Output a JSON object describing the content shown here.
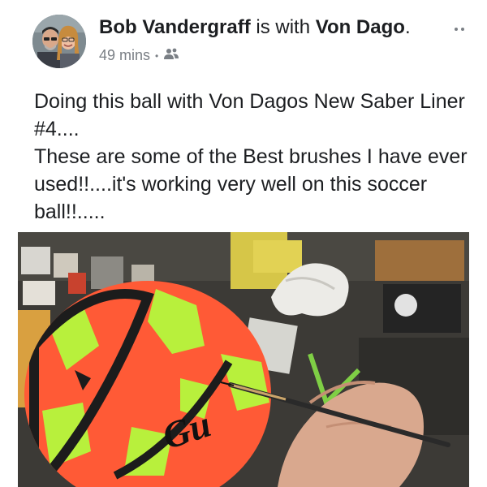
{
  "post": {
    "author_name": "Bob Vandergraff",
    "with_text": " is with ",
    "tagged_name": "Von Dago",
    "tagged_suffix": ".",
    "time": "49 mins",
    "separator": "•",
    "audience_icon": "friends-icon",
    "more_icon": "more-options-icon",
    "body_lines": [
      "Doing this ball with Von Dagos New Saber Liner #4....",
      "These are some of the Best brushes I have ever used!!....it's working very well on this soccer ball!!....."
    ],
    "photo": {
      "ball_lettering": "Gu",
      "colors": {
        "ball_orange": "#ff5a36",
        "ball_green": "#b8f03c",
        "background": "#3c3a36"
      }
    }
  }
}
